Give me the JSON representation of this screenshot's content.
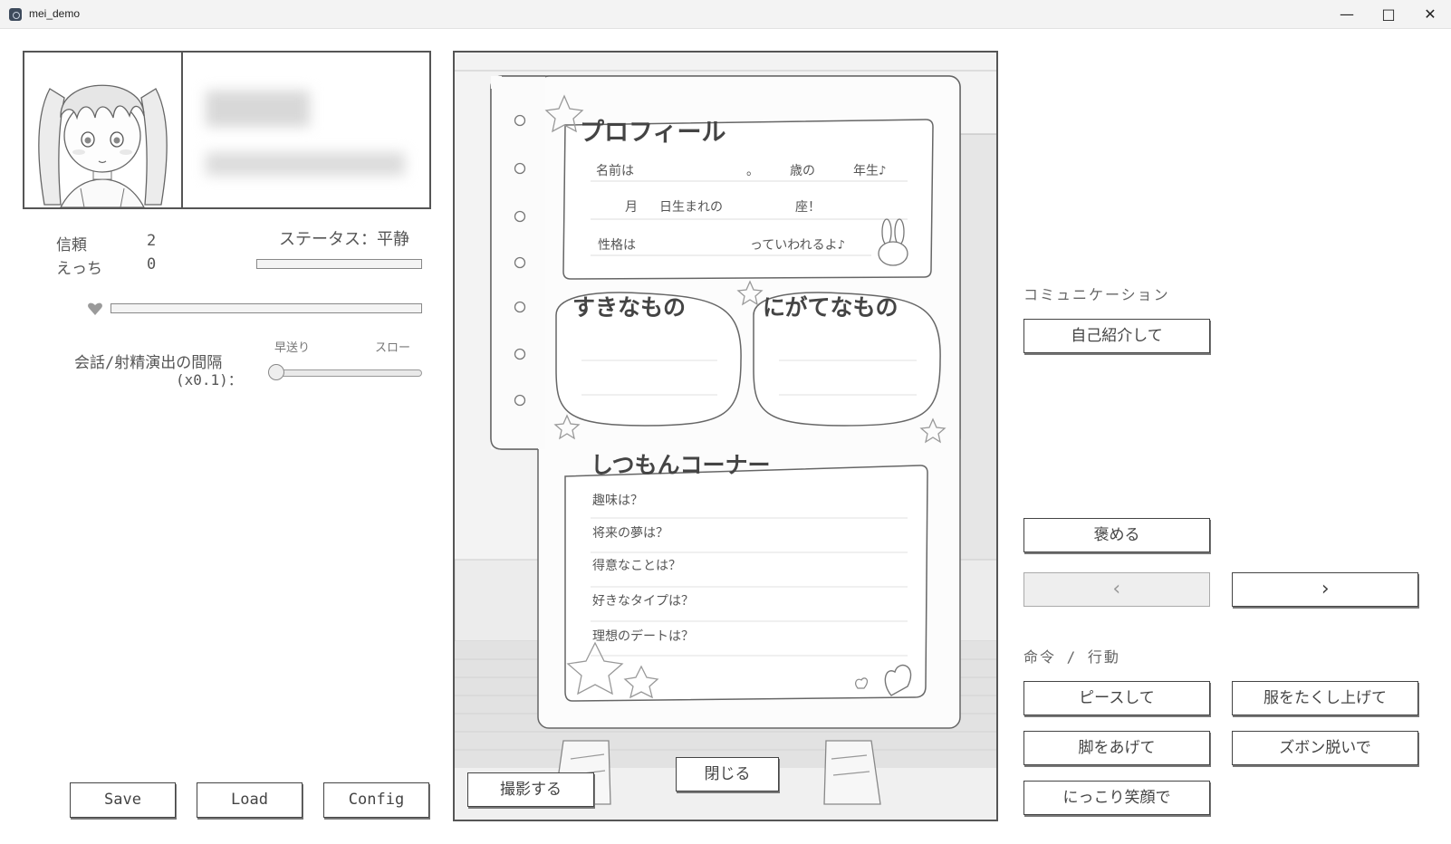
{
  "window": {
    "title": "mei_demo"
  },
  "status": {
    "trust_label": "信頼",
    "trust_value": "2",
    "ecchi_label": "えっち",
    "ecchi_value": "0",
    "status_text": "ステータス：平静",
    "status_bar_fraction": 0.0,
    "heart_bar_fraction": 0.0
  },
  "speed": {
    "label_line1": "会話/射精演出の間隔",
    "label_line2": "(x0.1)：",
    "fast_label": "早送り",
    "slow_label": "スロー",
    "slider_fraction": 0.0
  },
  "bottom_buttons": {
    "save": "Save",
    "load": "Load",
    "config": "Config"
  },
  "scene": {
    "profile_title": "プロフィール",
    "line1_a": "名前は",
    "line1_b": "。",
    "line1_c": "歳の",
    "line1_d": "年生♪",
    "line2_a": "月",
    "line2_b": "日生まれの",
    "line2_c": "座！",
    "line3_a": "性格は",
    "line3_b": "っていわれるよ♪",
    "likes_title": "すきなもの",
    "dislikes_title": "にがてなもの",
    "questions_title": "しつもんコーナー",
    "questions": [
      "趣味は？",
      "将来の夢は？",
      "得意なことは？",
      "好きなタイプは？",
      "理想のデートは？"
    ],
    "photo_button": "撮影する",
    "close_button": "閉じる"
  },
  "right_panel": {
    "communication_label": "コミュニケーション",
    "introduce_button": "自己紹介して",
    "praise_button": "褒める",
    "prev_button": "‹",
    "next_button": "›",
    "command_label": "命令 / 行動",
    "peace_button": "ピースして",
    "lift_clothes_button": "服をたくし上げて",
    "raise_legs_button": "脚をあげて",
    "pants_off_button": "ズボン脱いで",
    "smile_button": "にっこり笑顔で"
  }
}
